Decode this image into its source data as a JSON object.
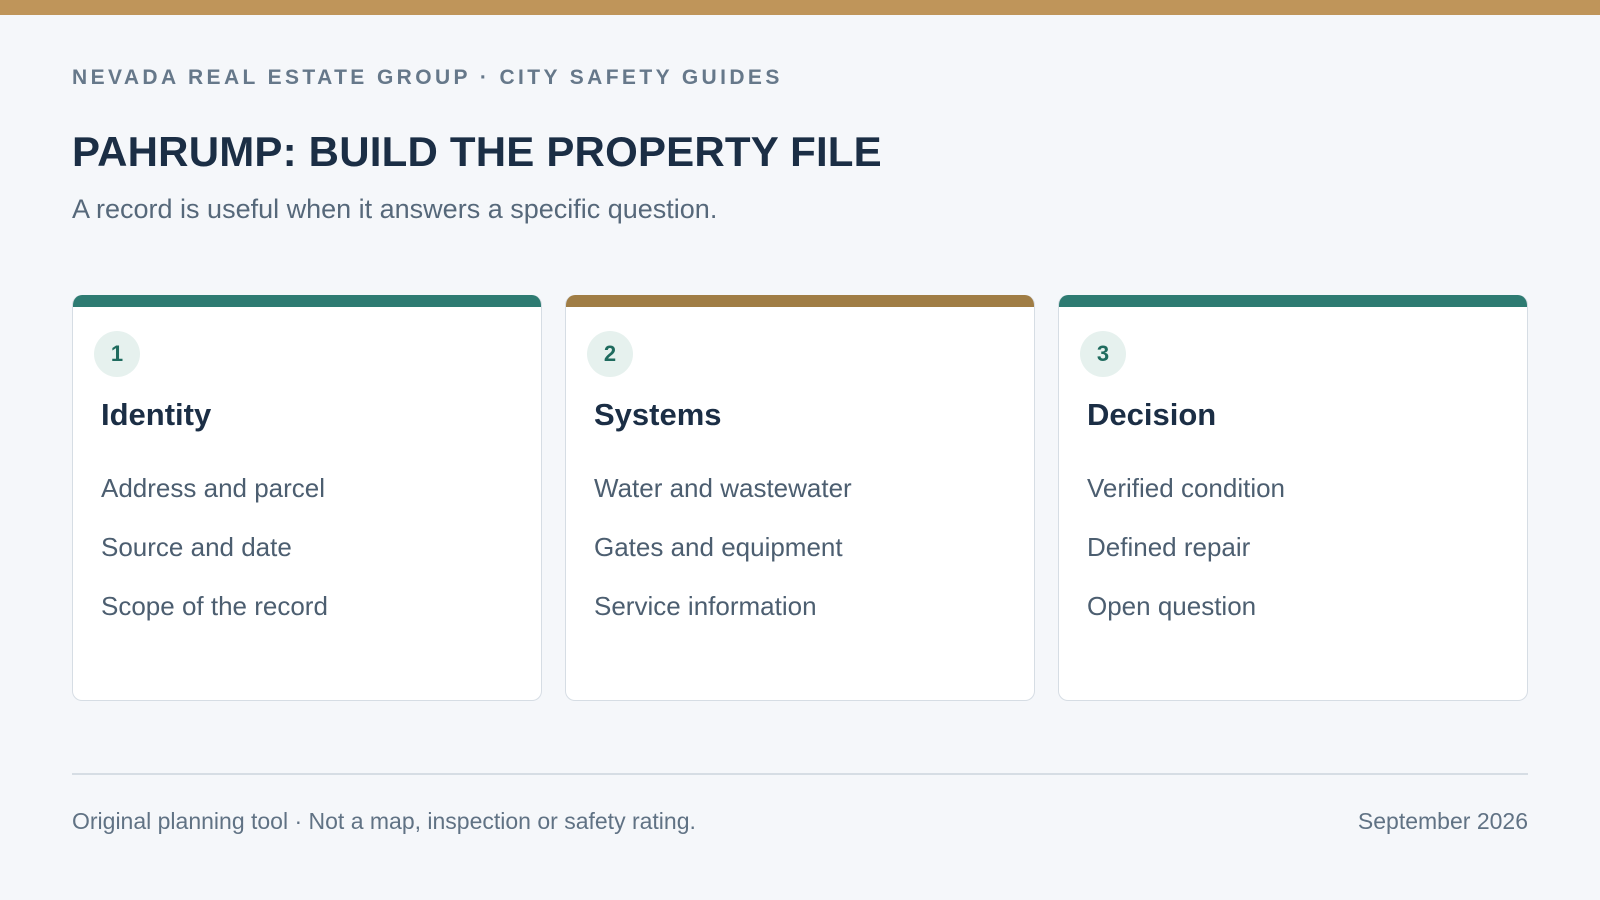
{
  "header": {
    "eyebrow": "NEVADA REAL ESTATE GROUP · CITY SAFETY GUIDES",
    "title": "PAHRUMP: BUILD THE PROPERTY FILE",
    "subtitle": "A record is useful when it answers a specific question."
  },
  "colors": {
    "top_bar": "#bf955a",
    "teal_accent": "#2e7b72",
    "gold_accent": "#a07d45"
  },
  "cards": [
    {
      "number": "1",
      "title": "Identity",
      "accent": "#2e7b72",
      "items": [
        "Address and parcel",
        "Source and date",
        "Scope of the record"
      ]
    },
    {
      "number": "2",
      "title": "Systems",
      "accent": "#a07d45",
      "items": [
        "Water and wastewater",
        "Gates and equipment",
        "Service information"
      ]
    },
    {
      "number": "3",
      "title": "Decision",
      "accent": "#2e7b72",
      "items": [
        "Verified condition",
        "Defined repair",
        "Open question"
      ]
    }
  ],
  "footer": {
    "note": "Original planning tool · Not a map, inspection or safety rating.",
    "date": "September 2026"
  }
}
